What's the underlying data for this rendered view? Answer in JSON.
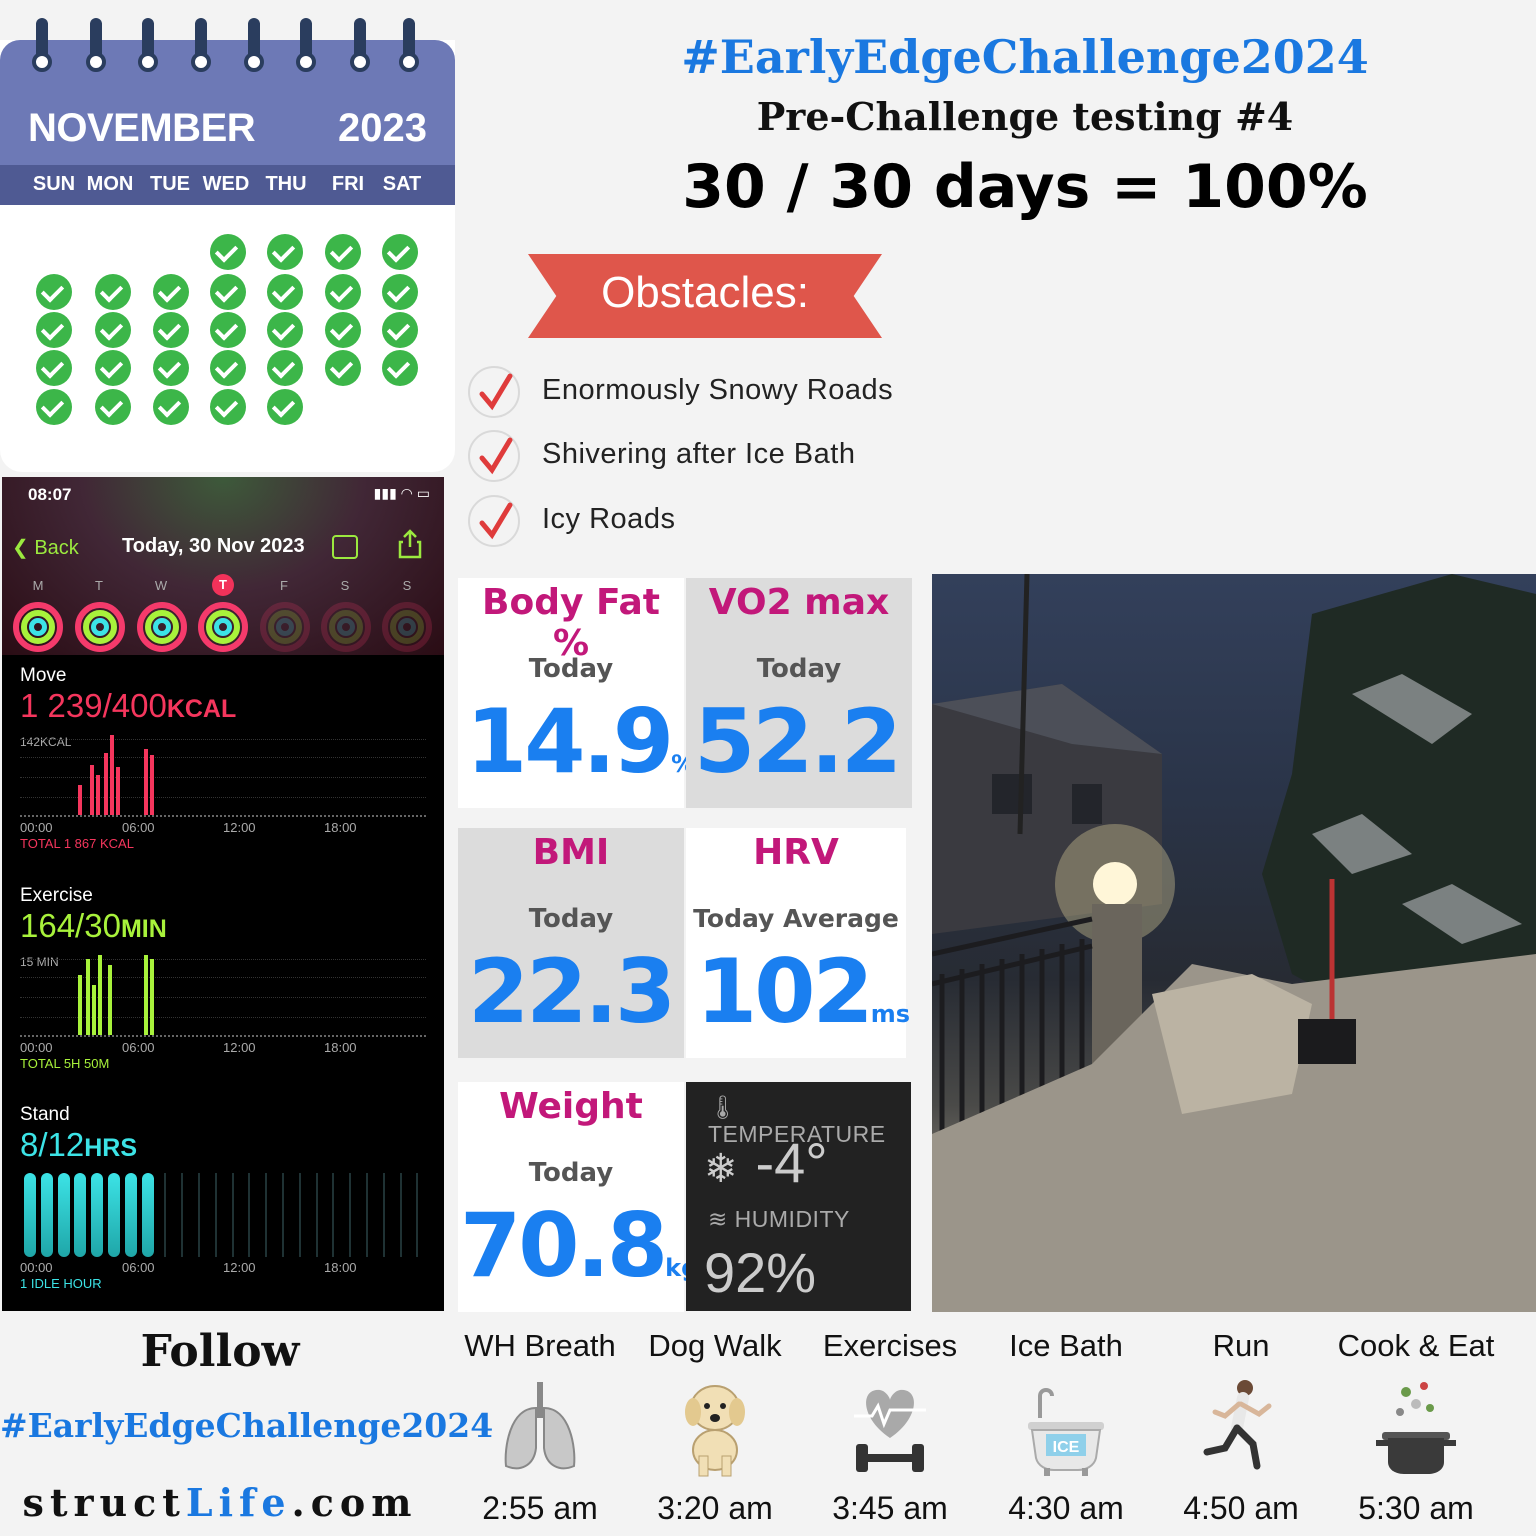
{
  "calendar": {
    "month": "NOVEMBER",
    "year": "2023",
    "weekdays": [
      "SUN",
      "MON",
      "TUE",
      "WED",
      "THU",
      "FRI",
      "SAT"
    ],
    "days_completed": 30
  },
  "header": {
    "hashtag": "#EarlyEdgeChallenge2024",
    "subtitle": "Pre-Challenge testing #4",
    "score": "30 / 30 days = 100%"
  },
  "obstacles": {
    "title": "Obstacles:",
    "items": [
      "Enormously Snowy Roads",
      "Shivering after Ice Bath",
      "Icy Roads"
    ]
  },
  "phone": {
    "time": "08:07",
    "back": "Back",
    "date": "Today, 30 Nov 2023",
    "weekdays": [
      "M",
      "T",
      "W",
      "T",
      "F",
      "S",
      "S"
    ],
    "today_index": 3,
    "move": {
      "label": "Move",
      "value": "1 239/400",
      "unit": "KCAL",
      "scale": "142KCAL",
      "total": "TOTAL 1 867 KCAL",
      "color": "#f5365d"
    },
    "exercise": {
      "label": "Exercise",
      "value": "164/30",
      "unit": "MIN",
      "scale": "15 MIN",
      "total": "TOTAL 5H 50M",
      "color": "#a8f23b"
    },
    "stand": {
      "label": "Stand",
      "value": "8/12",
      "unit": "HRS",
      "total": "1 IDLE HOUR",
      "color": "#3ce3e6"
    },
    "time_labels": [
      "00:00",
      "06:00",
      "12:00",
      "18:00"
    ]
  },
  "stats": {
    "body_fat": {
      "title": "Body Fat %",
      "sub": "Today",
      "value": "14.9",
      "unit": "%"
    },
    "vo2": {
      "title": "VO2 max",
      "sub": "Today",
      "value": "52.2",
      "unit": ""
    },
    "bmi": {
      "title": "BMI",
      "sub": "Today",
      "value": "22.3",
      "unit": ""
    },
    "hrv": {
      "title": "HRV",
      "sub": "Today Average",
      "value": "102",
      "unit": "ms"
    },
    "weight": {
      "title": "Weight",
      "sub": "Today",
      "value": "70.8",
      "unit": "kg"
    }
  },
  "weather": {
    "temp_label": "TEMPERATURE",
    "temp": "-4°",
    "humidity_label": "HUMIDITY",
    "humidity": "92%"
  },
  "footer": {
    "follow": "Follow",
    "hashtag": "#EarlyEdgeChallenge2024",
    "site_a": "struct",
    "site_b": "Life",
    "site_c": ".com"
  },
  "activities": [
    {
      "label": "WH Breath",
      "time": "2:55 am",
      "icon": "lungs-icon"
    },
    {
      "label": "Dog Walk",
      "time": "3:20 am",
      "icon": "dog-icon"
    },
    {
      "label": "Exercises",
      "time": "3:45 am",
      "icon": "dumbbell-heart-icon"
    },
    {
      "label": "Ice Bath",
      "time": "4:30 am",
      "icon": "ice-bath-icon"
    },
    {
      "label": "Run",
      "time": "4:50 am",
      "icon": "runner-icon"
    },
    {
      "label": "Cook & Eat",
      "time": "5:30 am",
      "icon": "cooking-pot-icon"
    }
  ]
}
